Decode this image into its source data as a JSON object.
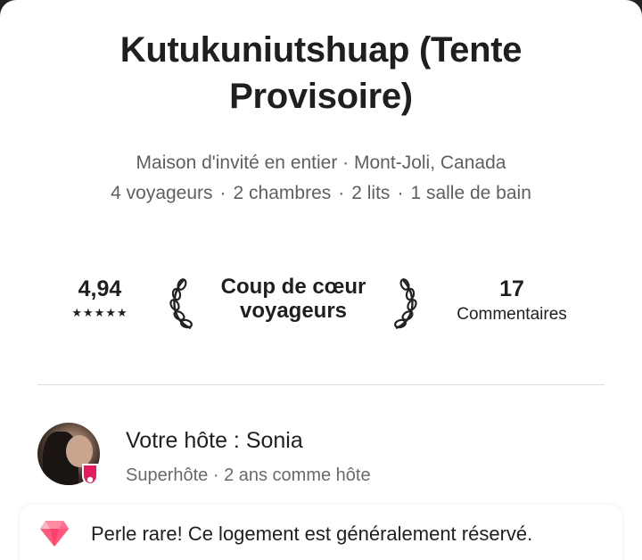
{
  "listing": {
    "title": "Kutukuniutshuap (Tente Provisoire)",
    "type_location": "Maison d'invité en entier · Mont-Joli, Canada",
    "guests": "4 voyageurs",
    "bedrooms": "2 chambres",
    "beds": "2 lits",
    "bathrooms": "1 salle de bain",
    "separator": "·"
  },
  "stats": {
    "rating": "4,94",
    "stars": "★★★★★",
    "star_count": 5,
    "guest_favorite_line1": "Coup de cœur",
    "guest_favorite_line2": "voyageurs",
    "reviews_count": "17",
    "reviews_label": "Commentaires"
  },
  "host": {
    "title": "Votre hôte : Sonia",
    "subtitle": "Superhôte · 2 ans comme hôte",
    "avatar_icon": "host-avatar-photo",
    "badge_icon": "superhost-badge-icon",
    "badge_color": "#e31c5f"
  },
  "rare_find": {
    "text": "Perle rare! Ce logement est généralement réservé.",
    "icon": "diamond-icon",
    "icon_color": "#ff5a7e"
  }
}
